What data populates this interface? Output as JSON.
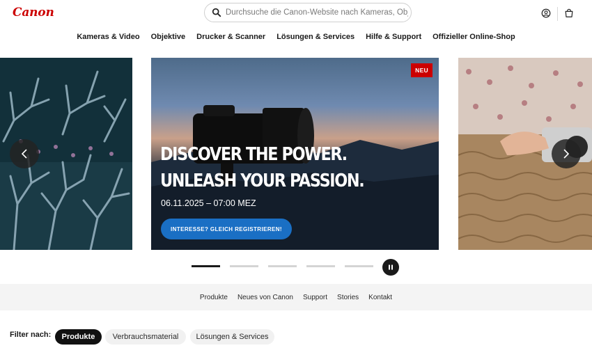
{
  "header": {
    "logo": "Canon",
    "search_placeholder": "Durchsuche die Canon-Website nach Kameras, Objekt"
  },
  "main_nav": [
    "Kameras & Video",
    "Objektive",
    "Drucker & Scanner",
    "Lösungen & Services",
    "Hilfe & Support",
    "Offizieller Online-Shop"
  ],
  "hero": {
    "badge": "NEU",
    "title": "DISCOVER THE POWER. UNLEASH YOUR PASSION.",
    "date": "06.11.2025 – 07:00 MEZ",
    "cta": "INTERESSE? GLEICH REGISTRIEREN!"
  },
  "carousel": {
    "slide_count": 5,
    "active_index": 0
  },
  "sub_nav": [
    "Produkte",
    "Neues von Canon",
    "Support",
    "Stories",
    "Kontakt"
  ],
  "filter": {
    "label": "Filter nach:",
    "chips": [
      "Produkte",
      "Verbrauchsmaterial",
      "Lösungen & Services"
    ],
    "active": "Produkte"
  },
  "colors": {
    "brand_red": "#cc0000",
    "cta_blue": "#1a6fc4"
  },
  "icons": [
    "search-icon",
    "account-icon",
    "cart-icon",
    "chevron-left-icon",
    "chevron-right-icon",
    "pause-icon"
  ]
}
